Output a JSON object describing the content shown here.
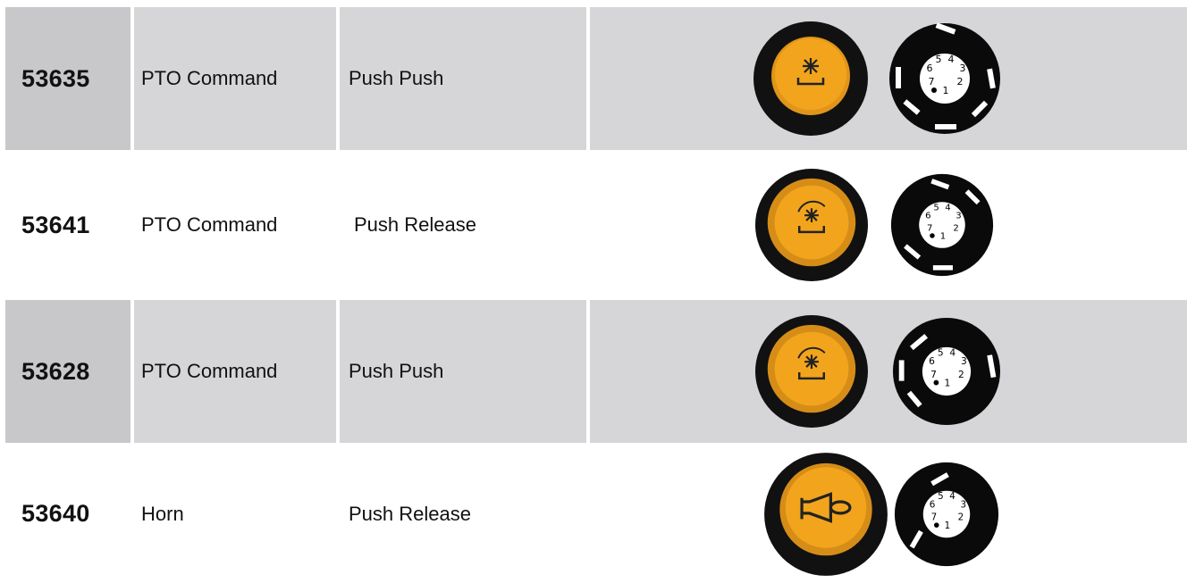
{
  "rows": [
    {
      "code": "53635",
      "function": "PTO Command",
      "action": "Push Push",
      "icon": "pto-icon",
      "shaded": true
    },
    {
      "code": "53641",
      "function": "PTO Command",
      "action": "Push Release",
      "icon": "pto-icon",
      "shaded": false
    },
    {
      "code": "53628",
      "function": "PTO Command",
      "action": "Push Push",
      "icon": "pto-icon",
      "shaded": true
    },
    {
      "code": "53640",
      "function": "Horn",
      "action": "Push Release",
      "icon": "horn-icon",
      "shaded": false
    }
  ],
  "pinout": {
    "pins": [
      "1",
      "2",
      "3",
      "4",
      "5",
      "6",
      "7"
    ]
  },
  "colors": {
    "button_yellow": "#f2a51c",
    "shade_dark": "#c8c8ca",
    "shade_light": "#d6d6d8"
  }
}
